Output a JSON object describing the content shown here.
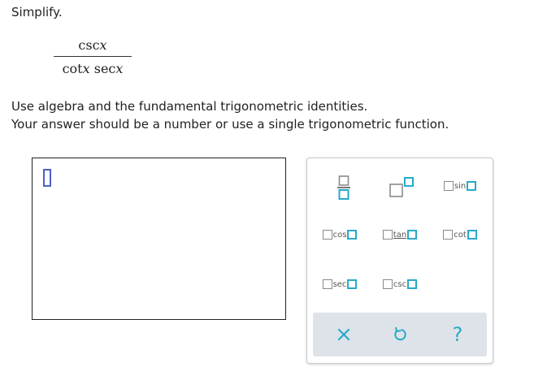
{
  "prompt": {
    "title": "Simplify.",
    "line1": "Use algebra and the fundamental trigonometric identities.",
    "line2": "Your answer should be a number or use a single trigonometric function."
  },
  "expression": {
    "numerator": "csc",
    "denominator_part1": "cot",
    "denominator_part2": " sec",
    "variable": "x"
  },
  "palette": {
    "functions": {
      "sin": "sin",
      "cos": "cos",
      "tan": "tan",
      "cot": "cot",
      "sec": "sec",
      "csc": "csc"
    },
    "controls": {
      "help": "?"
    }
  },
  "colors": {
    "accent": "#28a9c9",
    "cursor": "#4a60c8",
    "bottom_bar": "#dde3e8"
  },
  "icons": [
    "fraction-icon",
    "exponent-icon",
    "clear-icon",
    "undo-icon",
    "help-icon"
  ]
}
